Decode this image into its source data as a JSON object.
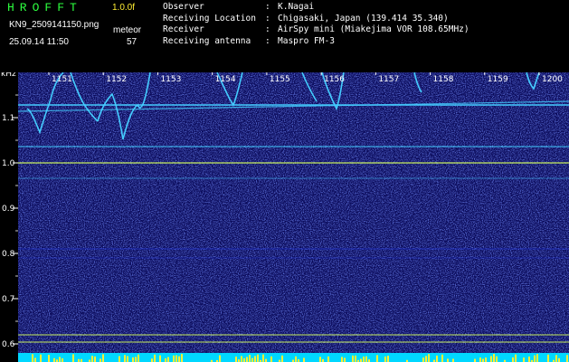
{
  "header": {
    "app_title": "HROFFT",
    "version": "1.0.0f",
    "filename": "KN9_2509141150.png",
    "meteor_label": "meteor",
    "datetime": "25.09.14 11:50",
    "meteor_count": "57"
  },
  "info": [
    {
      "key": "Observer",
      "value": "K.Nagai"
    },
    {
      "key": "Receiving Location",
      "value": "Chigasaki, Japan (139.414 35.340)"
    },
    {
      "key": "Receiver",
      "value": "AirSpy mini (Miakejima VOR 108.65MHz)"
    },
    {
      "key": "Receiving antenna",
      "value": "Maspro FM-3"
    }
  ],
  "colors": {
    "background": "#000000",
    "spectrum_bg": "#0a0a5a",
    "noise": "#2233cc",
    "carrier": "#44ccff",
    "reference_line": "#c8f060",
    "title_green": "#2dff3f",
    "version_yellow": "#ffee33",
    "bottom_band": "#00d8ff"
  },
  "axis": {
    "unit_label": "kHz",
    "frequency_ticks": [
      "1.1",
      "1.0",
      "0.9",
      "0.8",
      "0.7",
      "0.6"
    ],
    "frequency_values": [
      1.1,
      1.0,
      0.9,
      0.8,
      0.7,
      0.6
    ],
    "time_labels": [
      "1151",
      "1152",
      "1153",
      "1154",
      "1155",
      "1156",
      "1157",
      "1158",
      "1159",
      "1200"
    ]
  }
}
